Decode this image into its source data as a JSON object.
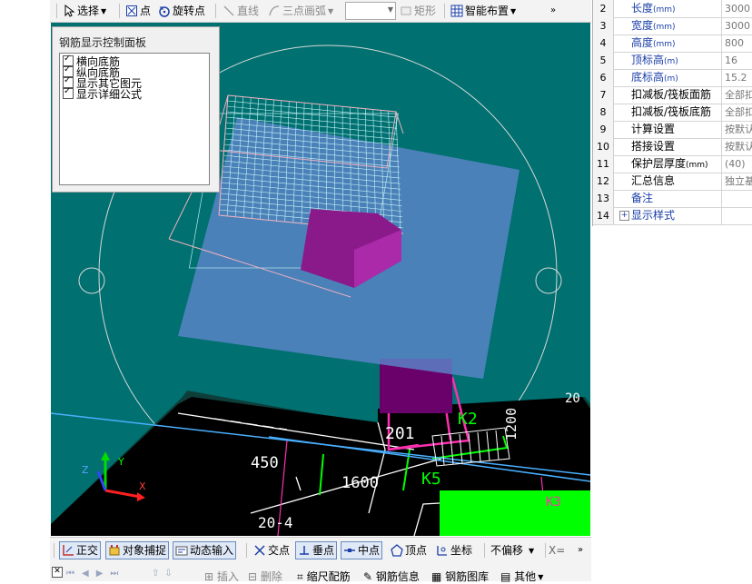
{
  "toolbar": {
    "select": "选择",
    "point": "点",
    "rotate_point": "旋转点",
    "line": "直线",
    "three_point_arc": "三点画弧",
    "rect": "矩形",
    "smart_layout": "智能布置"
  },
  "panel": {
    "title": "钢筋显示控制面板",
    "items": [
      "横向底筋",
      "纵向底筋",
      "显示其它图元",
      "显示详细公式"
    ]
  },
  "cad": {
    "labels": [
      "450",
      "1600",
      "K2",
      "K5",
      "1200",
      "201",
      "20-4",
      "K3",
      "20"
    ]
  },
  "axes": {
    "x": "X",
    "y": "Y",
    "z": "Z"
  },
  "bottom_toolbar": {
    "ortho": "正交",
    "object_snap": "对象捕捉",
    "dynamic_input": "动态输入",
    "intersection": "交点",
    "perpendicular": "垂点",
    "midpoint": "中点",
    "vertex": "顶点",
    "coordinate": "坐标",
    "offset_value": "不偏移",
    "x_label": "X="
  },
  "bottom_toolbar2": {
    "insert": "插入",
    "delete": "删除",
    "scale_rebar": "缩尺配筋",
    "rebar_info": "钢筋信息",
    "rebar_library": "钢筋图库",
    "other": "其他"
  },
  "properties": [
    {
      "num": "2",
      "name": "长度",
      "unit": "(mm)",
      "value": "3000"
    },
    {
      "num": "3",
      "name": "宽度",
      "unit": "(mm)",
      "value": "3000"
    },
    {
      "num": "4",
      "name": "高度",
      "unit": "(mm)",
      "value": "800"
    },
    {
      "num": "5",
      "name": "顶标高",
      "unit": "(m)",
      "value": "16"
    },
    {
      "num": "6",
      "name": "底标高",
      "unit": "(m)",
      "value": "15.2"
    },
    {
      "num": "7",
      "name": "扣减板/筏板面筋",
      "unit": "",
      "value": "全部扣"
    },
    {
      "num": "8",
      "name": "扣减板/筏板底筋",
      "unit": "",
      "value": "全部扣"
    },
    {
      "num": "9",
      "name": "计算设置",
      "unit": "",
      "value": "按默认"
    },
    {
      "num": "10",
      "name": "搭接设置",
      "unit": "",
      "value": "按默认"
    },
    {
      "num": "11",
      "name": "保护层厚度",
      "unit": "(mm)",
      "value": "(40)"
    },
    {
      "num": "12",
      "name": "汇总信息",
      "unit": "",
      "value": "独立基"
    },
    {
      "num": "13",
      "name": "备注",
      "unit": "",
      "value": ""
    },
    {
      "num": "14",
      "name": "显示样式",
      "unit": "",
      "value": ""
    }
  ]
}
